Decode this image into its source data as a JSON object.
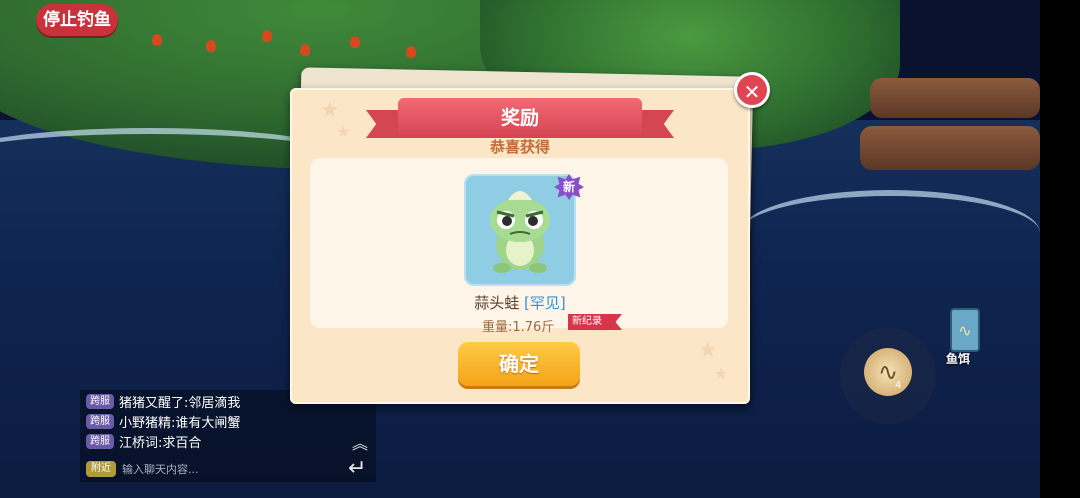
{
  "hud": {
    "stop_fishing_label": "停止钓鱼",
    "bait_label": "鱼饵",
    "bait_count": "4"
  },
  "reward_dialog": {
    "title": "奖励",
    "subtitle": "恭喜获得",
    "new_badge": "新",
    "fish_name": "蒜头蛙",
    "rarity": "[罕见]",
    "weight": "重量:1.76斤",
    "record_tag": "新纪录",
    "confirm_label": "确定"
  },
  "chat": {
    "messages": [
      {
        "tag": "跨服",
        "text": "猪猪又醒了:邻居滴我"
      },
      {
        "tag": "跨服",
        "text": "小野猪精:谁有大闸蟹"
      },
      {
        "tag": "跨服",
        "text": "江桥词:求百合"
      }
    ],
    "channel": "附近",
    "input_placeholder": "输入聊天内容..."
  },
  "colors": {
    "accent_red": "#d44652",
    "confirm_yellow": "#f3a318",
    "rarity_blue": "#3a8fd0"
  }
}
